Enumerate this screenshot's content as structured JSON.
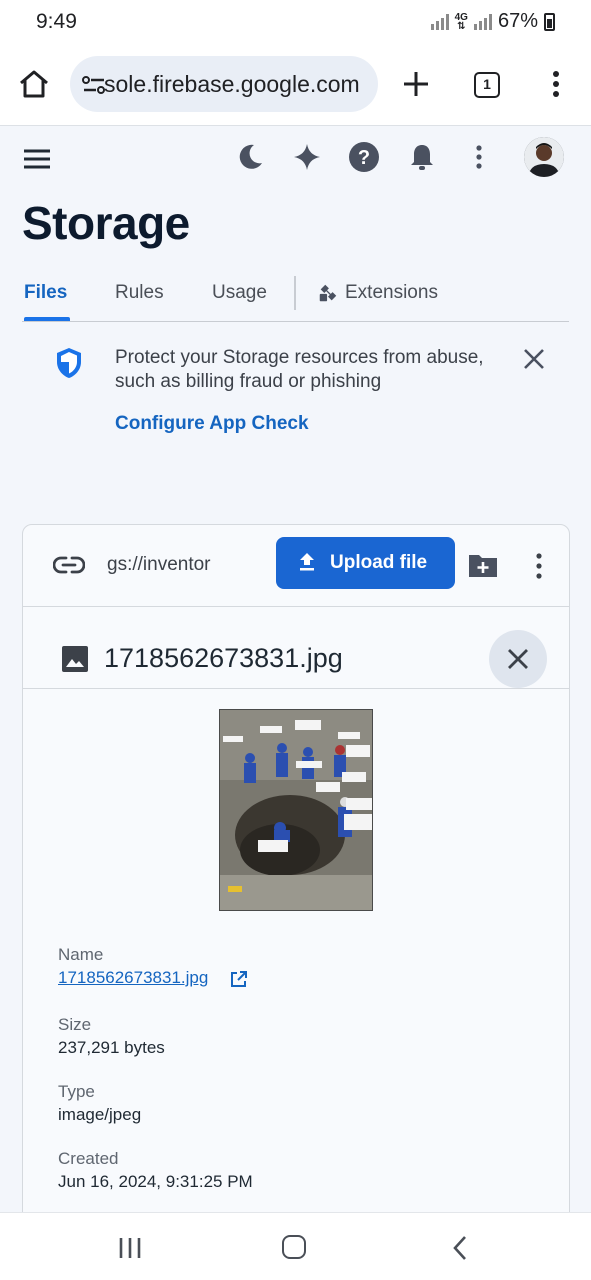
{
  "status_bar": {
    "time": "9:49",
    "network": "4G",
    "battery": "67%"
  },
  "browser": {
    "url": "sole.firebase.google.com",
    "tab_count": "1"
  },
  "header": {
    "icons": [
      "menu-icon",
      "dark-mode-icon",
      "gemini-sparkle-icon",
      "help-icon",
      "notifications-icon",
      "more-vert-icon",
      "avatar"
    ]
  },
  "page": {
    "title": "Storage"
  },
  "tabs": [
    {
      "label": "Files",
      "active": true
    },
    {
      "label": "Rules"
    },
    {
      "label": "Usage"
    },
    {
      "label": "Extensions"
    }
  ],
  "banner": {
    "text": "Protect your Storage resources from abuse, such as billing fraud or phishing",
    "link": "Configure App Check"
  },
  "toolbar": {
    "bucket_path": "gs://inventor",
    "upload_label": "Upload file"
  },
  "file": {
    "title": "1718562673831.jpg",
    "details": {
      "name_label": "Name",
      "name_value": "1718562673831.jpg",
      "size_label": "Size",
      "size_value": "237,291 bytes",
      "type_label": "Type",
      "type_value": "image/jpeg",
      "created_label": "Created",
      "created_value": "Jun 16, 2024, 9:31:25 PM"
    }
  },
  "colors": {
    "accent": "#1a66d2",
    "link": "#1565c0",
    "background": "#f3f6fb",
    "shield": "#1a73e8"
  }
}
